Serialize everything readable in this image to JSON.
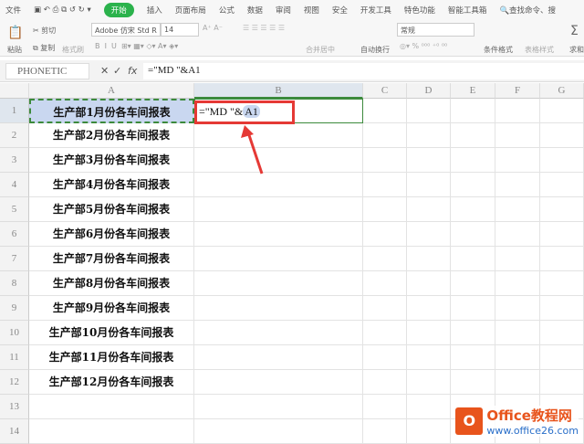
{
  "menu": {
    "file": "文件",
    "tabs": [
      "开始",
      "插入",
      "页面布局",
      "公式",
      "数据",
      "审阅",
      "视图",
      "安全",
      "开发工具",
      "特色功能",
      "智能工具箱"
    ],
    "search": "查找命令、搜"
  },
  "ribbon": {
    "paste": "粘贴",
    "cut": "剪切",
    "copy": "复制",
    "format_painter": "格式刷",
    "font": "Adobe 仿宋 Std R",
    "size": "14",
    "merge": "合并居中",
    "wrap": "自动换行",
    "number_format": "常规",
    "cond_format": "条件格式",
    "table_style": "表格样式",
    "sum": "求和"
  },
  "formula_bar": {
    "name_box": "PHONETIC",
    "cancel": "✕",
    "confirm": "✓",
    "fx": "fx",
    "formula": "=\"MD \"&A1"
  },
  "columns": [
    "A",
    "B",
    "C",
    "D",
    "E",
    "F",
    "G"
  ],
  "rows": [
    "1",
    "2",
    "3",
    "4",
    "5",
    "6",
    "7",
    "8",
    "9",
    "10",
    "11",
    "12",
    "13",
    "14"
  ],
  "cells_a": [
    "生产部1月份各车间报表",
    "生产部2月份各车间报表",
    "生产部3月份各车间报表",
    "生产部4月份各车间报表",
    "生产部5月份各车间报表",
    "生产部6月份各车间报表",
    "生产部7月份各车间报表",
    "生产部8月份各车间报表",
    "生产部9月份各车间报表",
    "生产部10月份各车间报表",
    "生产部11月份各车间报表",
    "生产部12月份各车间报表"
  ],
  "b1": {
    "prefix": "=\"MD \"&",
    "ref": "A1"
  },
  "watermark": {
    "brand": "Office教程网",
    "url": "www.office26.com"
  },
  "colors": {
    "accent": "#2bb24c",
    "highlight": "#e53935",
    "selected": "#c9d7f0"
  }
}
